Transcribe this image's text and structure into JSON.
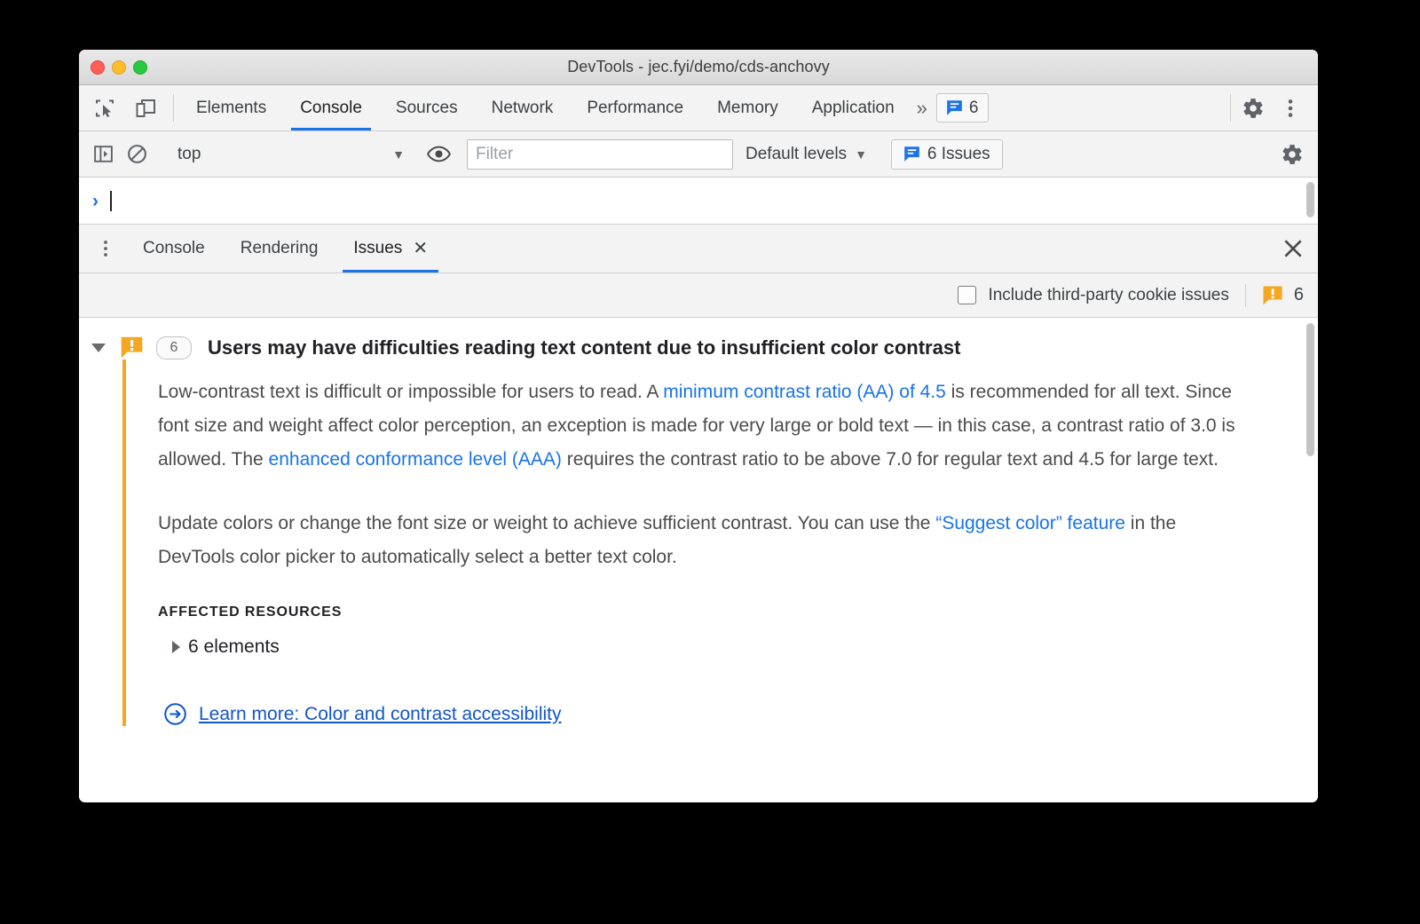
{
  "window": {
    "title": "DevTools - jec.fyi/demo/cds-anchovy",
    "traffic_lights": [
      "close",
      "minimize",
      "zoom"
    ]
  },
  "main_tabbar": {
    "left_icons": [
      {
        "name": "inspect-element-icon",
        "label": "Inspect element"
      },
      {
        "name": "device-toolbar-icon",
        "label": "Toggle device toolbar"
      }
    ],
    "tabs": [
      {
        "label": "Elements",
        "selected": false
      },
      {
        "label": "Console",
        "selected": true
      },
      {
        "label": "Sources",
        "selected": false
      },
      {
        "label": "Network",
        "selected": false
      },
      {
        "label": "Performance",
        "selected": false
      },
      {
        "label": "Memory",
        "selected": false
      },
      {
        "label": "Application",
        "selected": false
      }
    ],
    "more_tabs_label": "»",
    "issues_badge": {
      "count": "6",
      "icon": "issues-icon"
    },
    "settings_label": "Settings",
    "menu_label": "Customize and control DevTools"
  },
  "console_toolbar": {
    "sidebar_toggle": "console-sidebar-icon",
    "clear_label": "clear-console-icon",
    "context": {
      "value": "top",
      "caret": "▼"
    },
    "eye_icon": "live-expression-icon",
    "filter": {
      "value": "",
      "placeholder": "Filter"
    },
    "levels": {
      "label": "Default levels",
      "caret": "▼"
    },
    "issues_button": {
      "label": "6 Issues",
      "icon": "issues-icon"
    },
    "settings_icon": "gear-icon"
  },
  "console_prompt": {
    "chevron": "›",
    "value": ""
  },
  "drawer": {
    "menu_icon": "drawer-menu-icon",
    "tabs": [
      {
        "label": "Console",
        "selected": false,
        "closable": false
      },
      {
        "label": "Rendering",
        "selected": false,
        "closable": false
      },
      {
        "label": "Issues",
        "selected": true,
        "closable": true,
        "close_glyph": "✕"
      }
    ],
    "close_glyph": "✕"
  },
  "issues_filter": {
    "checkbox": {
      "label": "Include third-party cookie issues",
      "checked": false
    },
    "warning_icon": "warning-issue-icon",
    "warning_count": "6"
  },
  "issue": {
    "expanded": true,
    "icon": "warning-issue-icon",
    "count": "6",
    "title": "Users may have difficulties reading text content due to insufficient color contrast",
    "paragraph1": {
      "part1": "Low-contrast text is difficult or impossible for users to read. A ",
      "link1": "minimum contrast ratio (AA) of 4.5",
      "part2": " is recommended for all text. Since font size and weight affect color perception, an exception is made for very large or bold text — in this case, a contrast ratio of 3.0 is allowed. The ",
      "link2": "enhanced conformance level (AAA)",
      "part3": " requires the contrast ratio to be above 7.0 for regular text and 4.5 for large text."
    },
    "paragraph2": {
      "part1": "Update colors or change the font size or weight to achieve sufficient contrast. You can use the ",
      "link1": "“Suggest color” feature",
      "part2": " in the DevTools color picker to automatically select a better text color."
    },
    "affected_resources_label": "AFFECTED RESOURCES",
    "affected_resources_value": "6 elements",
    "learn_more": {
      "icon": "arrow-in-circle-icon",
      "label": "Learn more: Color and contrast accessibility"
    }
  },
  "colors": {
    "accent_blue": "#1a73e8",
    "link_blue": "#1155cc",
    "warning_orange": "#f5a623",
    "text_primary": "#202124",
    "text_secondary": "#4b4b4b",
    "chrome_bg": "#f3f3f3",
    "content_bg": "#ffffff",
    "desktop_bg": "#000000"
  }
}
